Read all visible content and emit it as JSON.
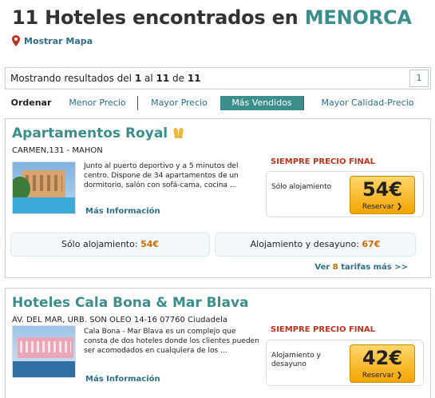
{
  "header": {
    "title_count": "11",
    "title_text": "Hoteles encontrados en",
    "city": "MENORCA",
    "map_link": "Mostrar Mapa"
  },
  "results": {
    "prefix": "Mostrando resultados del",
    "from": "1",
    "al": "al",
    "to": "11",
    "de": "de",
    "total": "11",
    "page": "1"
  },
  "sort": {
    "label": "Ordenar",
    "options": [
      "Menor Precio",
      "Mayor Precio",
      "Más Vendidos",
      "Mayor Calidad-Precio"
    ],
    "active": "Más Vendidos"
  },
  "hotels": [
    {
      "name": "Apartamentos Royal",
      "address": "CARMEN,131 - MAHON",
      "description": "Junto al puerto deportivo y a 5 minutos del centro. Dispone de 34 apartamentos de un dormitorio, salón con sofá-cama, cocina ...",
      "more_info": "Más Información",
      "price_header": "SIEMPRE PRECIO FINAL",
      "board": "Sólo alojamiento",
      "price": "54€",
      "reserve": "Reservar ❯",
      "rates": [
        {
          "label": "Sólo alojamiento:",
          "price": "54€"
        },
        {
          "label": "Alojamiento y desayuno:",
          "price": "67€"
        }
      ],
      "more_rates_prefix": "Ver",
      "more_rates_count": "8",
      "more_rates_suffix": "tarifas más >>"
    },
    {
      "name": "Hoteles Cala Bona & Mar Blava",
      "address": "AV. DEL MAR, URB. SON OLEO 14-16 07760 Ciudadela",
      "description": "Cala Bona - Mar Blava es un complejo que consta de dos hoteles donde los clientes pueden ser acomodados en cualquiera de los ...",
      "more_info": "Más Información",
      "price_header": "SIEMPRE PRECIO FINAL",
      "board": "Alojamiento y desayuno",
      "price": "42€",
      "reserve": "Reservar ❯"
    }
  ],
  "colors": {
    "accent": "#3a8e8b",
    "link": "#2c6f86",
    "price_header": "#c0331e",
    "button": "#f2a500"
  }
}
